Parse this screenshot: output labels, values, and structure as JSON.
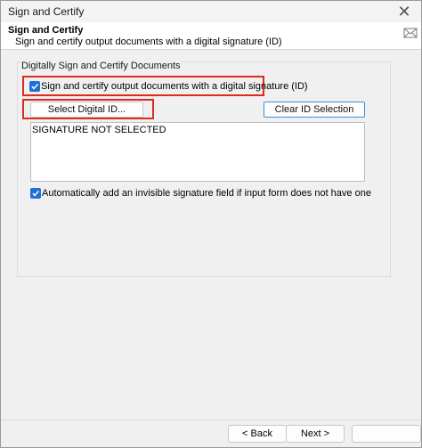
{
  "window": {
    "title": "Sign and Certify"
  },
  "header": {
    "title": "Sign and Certify",
    "subtitle": "Sign and certify output documents with a digital signature (ID)"
  },
  "group": {
    "label": "Digitally Sign and Certify Documents",
    "sign_checkbox": {
      "label": "Sign and certify output documents with a digital signature (ID)",
      "checked": true
    },
    "select_id_button": "Select Digital ID...",
    "clear_id_button": "Clear ID Selection",
    "signature_text": "SIGNATURE NOT SELECTED",
    "auto_add_checkbox": {
      "label": "Automatically add an invisible signature field if input form does not have one",
      "checked": true
    }
  },
  "footer": {
    "back_label": "< Back",
    "next_label": "Next >",
    "third_label": ""
  },
  "colors": {
    "checkbox": "#1f6fd6",
    "highlight": "#e0291e",
    "focus": "#3b8fd9"
  }
}
